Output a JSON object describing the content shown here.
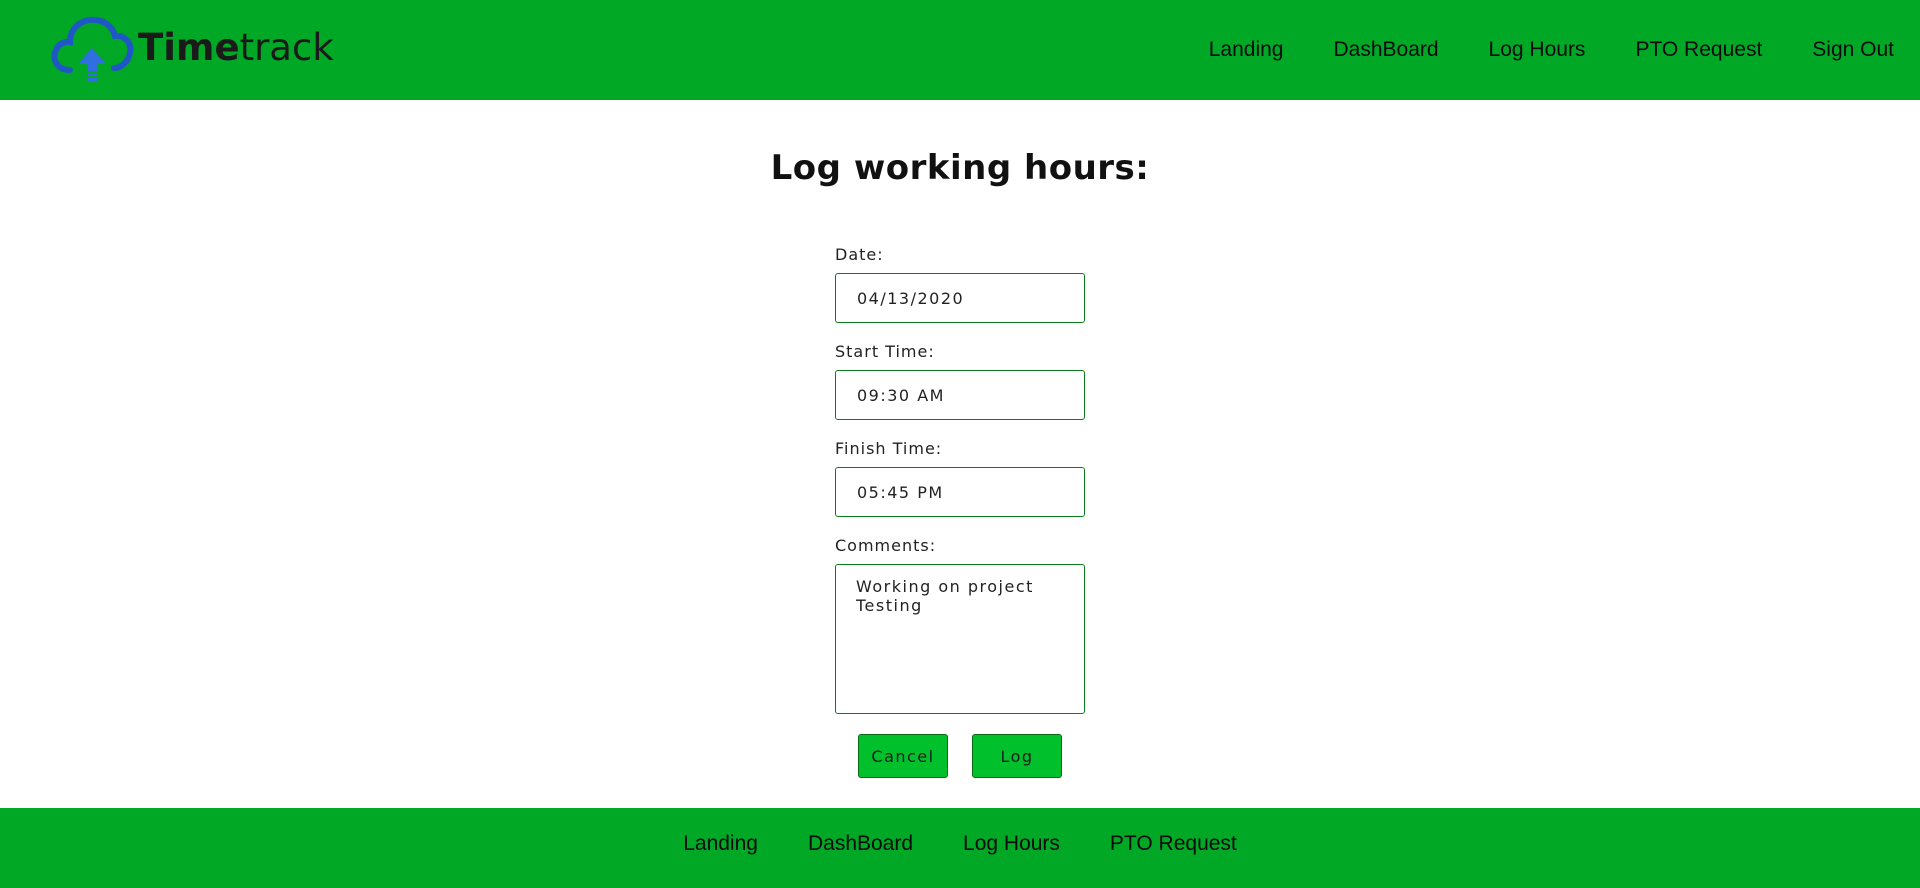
{
  "brand": {
    "name_bold": "Time",
    "name_light": "track",
    "icon": "cloud-upload-icon",
    "icon_color": "#1f57c7",
    "accent_color": "#00a825"
  },
  "nav": {
    "items": [
      {
        "label": "Landing"
      },
      {
        "label": "DashBoard"
      },
      {
        "label": "Log Hours"
      },
      {
        "label": "PTO Request"
      },
      {
        "label": "Sign Out"
      }
    ]
  },
  "page": {
    "title": "Log working hours:"
  },
  "form": {
    "date": {
      "label": "Date:",
      "value": "04/13/2020"
    },
    "start_time": {
      "label": "Start Time:",
      "value": "09:30 AM"
    },
    "finish_time": {
      "label": "Finish Time:",
      "value": "05:45 PM"
    },
    "comments": {
      "label": "Comments:",
      "value": "Working on project Testing"
    },
    "cancel_label": "Cancel",
    "log_label": "Log"
  },
  "footer": {
    "items": [
      {
        "label": "Landing"
      },
      {
        "label": "DashBoard"
      },
      {
        "label": "Log Hours"
      },
      {
        "label": "PTO Request"
      }
    ]
  }
}
